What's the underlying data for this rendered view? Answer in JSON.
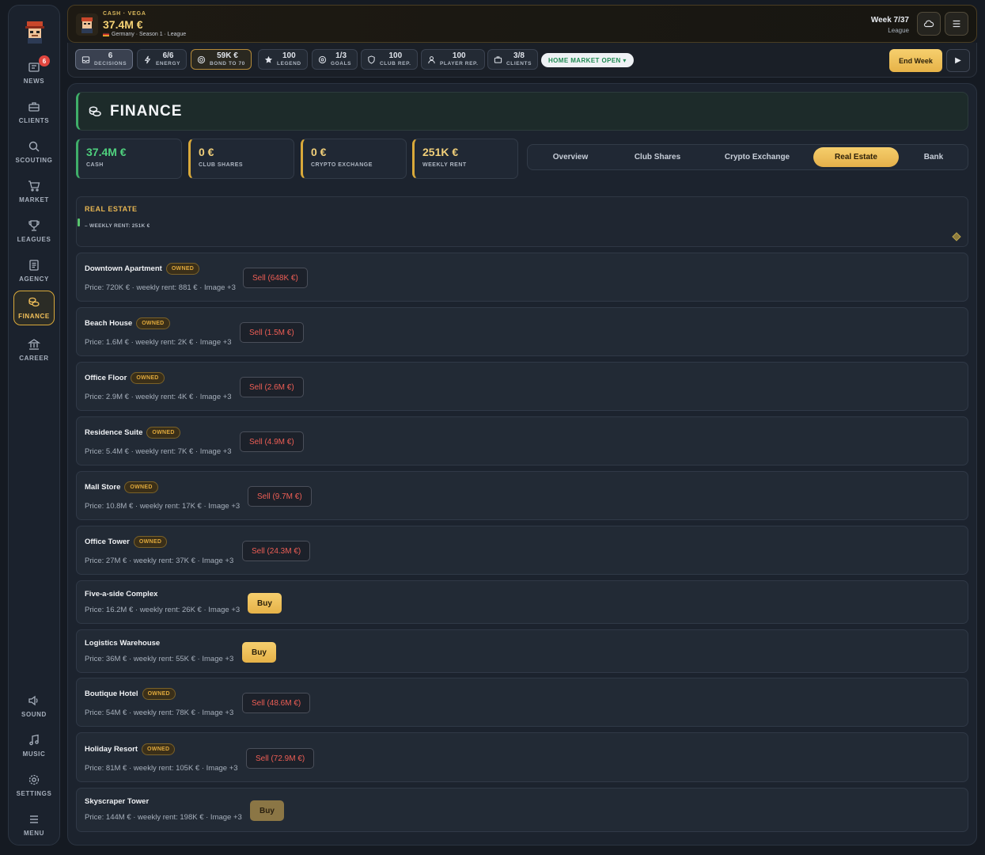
{
  "sidebar": {
    "news_badge": "6",
    "items": [
      {
        "label": "NEWS",
        "icon": "news-icon"
      },
      {
        "label": "CLIENTS",
        "icon": "briefcase-icon"
      },
      {
        "label": "SCOUTING",
        "icon": "search-icon"
      },
      {
        "label": "MARKET",
        "icon": "cart-icon"
      },
      {
        "label": "LEAGUES",
        "icon": "trophy-icon"
      },
      {
        "label": "AGENCY",
        "icon": "document-icon"
      },
      {
        "label": "FINANCE",
        "icon": "coins-icon"
      },
      {
        "label": "CAREER",
        "icon": "bank-icon"
      }
    ],
    "bottom_items": [
      {
        "label": "SOUND",
        "icon": "speaker-icon"
      },
      {
        "label": "MUSIC",
        "icon": "music-icon"
      },
      {
        "label": "SETTINGS",
        "icon": "gear-icon"
      },
      {
        "label": "MENU",
        "icon": "menu-icon"
      }
    ]
  },
  "header": {
    "caption": "CASH · VEGA",
    "cash": "37.4M €",
    "subtitle": "Germany · Season 1 · League",
    "week": "Week 7/37",
    "week_sub": "League"
  },
  "stats": [
    {
      "value": "6",
      "label": "DECISIONS",
      "icon": "inbox-icon"
    },
    {
      "value": "6/6",
      "label": "ENERGY",
      "icon": "bolt-icon"
    },
    {
      "value": "59K €",
      "label": "BOND TO 70",
      "icon": "target-icon"
    },
    {
      "value": "100",
      "label": "LEGEND",
      "icon": "star-icon"
    },
    {
      "value": "1/3",
      "label": "GOALS",
      "icon": "goal-icon"
    },
    {
      "value": "100",
      "label": "CLUB REP.",
      "icon": "shield-icon"
    },
    {
      "value": "100",
      "label": "PLAYER REP.",
      "icon": "person-icon"
    },
    {
      "value": "3/8",
      "label": "CLIENTS",
      "icon": "briefcase-icon"
    }
  ],
  "market_status": "HOME MARKET OPEN ▾",
  "end_week_label": "End Week",
  "page": {
    "title": "FINANCE"
  },
  "kpis": [
    {
      "value": "37.4M €",
      "label": "CASH"
    },
    {
      "value": "0 €",
      "label": "CLUB SHARES"
    },
    {
      "value": "0 €",
      "label": "CRYPTO EXCHANGE"
    },
    {
      "value": "251K €",
      "label": "WEEKLY RENT"
    }
  ],
  "tabs": [
    "Overview",
    "Club Shares",
    "Crypto Exchange",
    "Real Estate",
    "Bank"
  ],
  "active_tab": "Real Estate",
  "real_estate": {
    "title": "REAL ESTATE",
    "weekly_rent": "– WEEKLY RENT: 251K €",
    "owned_label": "OWNED",
    "properties": [
      {
        "name": "Downtown Apartment",
        "owned": true,
        "info": "Price: 720K € · weekly rent: 881 € · Image +3",
        "action": "Sell (648K €)"
      },
      {
        "name": "Beach House",
        "owned": true,
        "info": "Price: 1.6M € · weekly rent: 2K € · Image +3",
        "action": "Sell (1.5M €)"
      },
      {
        "name": "Office Floor",
        "owned": true,
        "info": "Price: 2.9M € · weekly rent: 4K € · Image +3",
        "action": "Sell (2.6M €)"
      },
      {
        "name": "Residence Suite",
        "owned": true,
        "info": "Price: 5.4M € · weekly rent: 7K € · Image +3",
        "action": "Sell (4.9M €)"
      },
      {
        "name": "Mall Store",
        "owned": true,
        "info": "Price: 10.8M € · weekly rent: 17K € · Image +3",
        "action": "Sell (9.7M €)"
      },
      {
        "name": "Office Tower",
        "owned": true,
        "info": "Price: 27M € · weekly rent: 37K € · Image +3",
        "action": "Sell (24.3M €)"
      },
      {
        "name": "Five-a-side Complex",
        "owned": false,
        "info": "Price: 16.2M € · weekly rent: 26K € · Image +3",
        "action": "Buy"
      },
      {
        "name": "Logistics Warehouse",
        "owned": false,
        "info": "Price: 36M € · weekly rent: 55K € · Image +3",
        "action": "Buy"
      },
      {
        "name": "Boutique Hotel",
        "owned": true,
        "info": "Price: 54M € · weekly rent: 78K € · Image +3",
        "action": "Sell (48.6M €)"
      },
      {
        "name": "Holiday Resort",
        "owned": true,
        "info": "Price: 81M € · weekly rent: 105K € · Image +3",
        "action": "Sell (72.9M €)"
      },
      {
        "name": "Skyscraper Tower",
        "owned": false,
        "info": "Price: 144M € · weekly rent: 198K € · Image +3",
        "action": "Buy",
        "disabled": true
      }
    ]
  }
}
